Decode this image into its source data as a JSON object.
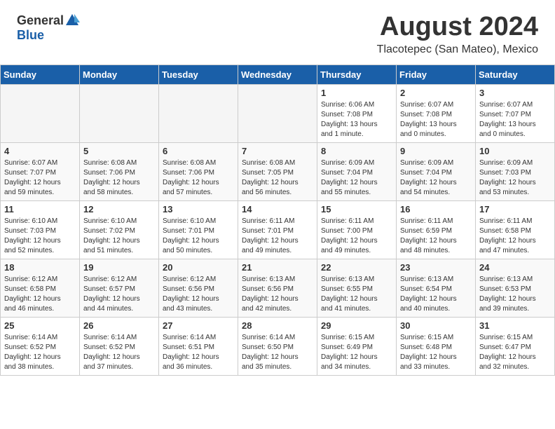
{
  "header": {
    "logo_general": "General",
    "logo_blue": "Blue",
    "month_year": "August 2024",
    "location": "Tlacotepec (San Mateo), Mexico"
  },
  "weekdays": [
    "Sunday",
    "Monday",
    "Tuesday",
    "Wednesday",
    "Thursday",
    "Friday",
    "Saturday"
  ],
  "weeks": [
    [
      {
        "day": "",
        "info": ""
      },
      {
        "day": "",
        "info": ""
      },
      {
        "day": "",
        "info": ""
      },
      {
        "day": "",
        "info": ""
      },
      {
        "day": "1",
        "info": "Sunrise: 6:06 AM\nSunset: 7:08 PM\nDaylight: 13 hours\nand 1 minute."
      },
      {
        "day": "2",
        "info": "Sunrise: 6:07 AM\nSunset: 7:08 PM\nDaylight: 13 hours\nand 0 minutes."
      },
      {
        "day": "3",
        "info": "Sunrise: 6:07 AM\nSunset: 7:07 PM\nDaylight: 13 hours\nand 0 minutes."
      }
    ],
    [
      {
        "day": "4",
        "info": "Sunrise: 6:07 AM\nSunset: 7:07 PM\nDaylight: 12 hours\nand 59 minutes."
      },
      {
        "day": "5",
        "info": "Sunrise: 6:08 AM\nSunset: 7:06 PM\nDaylight: 12 hours\nand 58 minutes."
      },
      {
        "day": "6",
        "info": "Sunrise: 6:08 AM\nSunset: 7:06 PM\nDaylight: 12 hours\nand 57 minutes."
      },
      {
        "day": "7",
        "info": "Sunrise: 6:08 AM\nSunset: 7:05 PM\nDaylight: 12 hours\nand 56 minutes."
      },
      {
        "day": "8",
        "info": "Sunrise: 6:09 AM\nSunset: 7:04 PM\nDaylight: 12 hours\nand 55 minutes."
      },
      {
        "day": "9",
        "info": "Sunrise: 6:09 AM\nSunset: 7:04 PM\nDaylight: 12 hours\nand 54 minutes."
      },
      {
        "day": "10",
        "info": "Sunrise: 6:09 AM\nSunset: 7:03 PM\nDaylight: 12 hours\nand 53 minutes."
      }
    ],
    [
      {
        "day": "11",
        "info": "Sunrise: 6:10 AM\nSunset: 7:03 PM\nDaylight: 12 hours\nand 52 minutes."
      },
      {
        "day": "12",
        "info": "Sunrise: 6:10 AM\nSunset: 7:02 PM\nDaylight: 12 hours\nand 51 minutes."
      },
      {
        "day": "13",
        "info": "Sunrise: 6:10 AM\nSunset: 7:01 PM\nDaylight: 12 hours\nand 50 minutes."
      },
      {
        "day": "14",
        "info": "Sunrise: 6:11 AM\nSunset: 7:01 PM\nDaylight: 12 hours\nand 49 minutes."
      },
      {
        "day": "15",
        "info": "Sunrise: 6:11 AM\nSunset: 7:00 PM\nDaylight: 12 hours\nand 49 minutes."
      },
      {
        "day": "16",
        "info": "Sunrise: 6:11 AM\nSunset: 6:59 PM\nDaylight: 12 hours\nand 48 minutes."
      },
      {
        "day": "17",
        "info": "Sunrise: 6:11 AM\nSunset: 6:58 PM\nDaylight: 12 hours\nand 47 minutes."
      }
    ],
    [
      {
        "day": "18",
        "info": "Sunrise: 6:12 AM\nSunset: 6:58 PM\nDaylight: 12 hours\nand 46 minutes."
      },
      {
        "day": "19",
        "info": "Sunrise: 6:12 AM\nSunset: 6:57 PM\nDaylight: 12 hours\nand 44 minutes."
      },
      {
        "day": "20",
        "info": "Sunrise: 6:12 AM\nSunset: 6:56 PM\nDaylight: 12 hours\nand 43 minutes."
      },
      {
        "day": "21",
        "info": "Sunrise: 6:13 AM\nSunset: 6:56 PM\nDaylight: 12 hours\nand 42 minutes."
      },
      {
        "day": "22",
        "info": "Sunrise: 6:13 AM\nSunset: 6:55 PM\nDaylight: 12 hours\nand 41 minutes."
      },
      {
        "day": "23",
        "info": "Sunrise: 6:13 AM\nSunset: 6:54 PM\nDaylight: 12 hours\nand 40 minutes."
      },
      {
        "day": "24",
        "info": "Sunrise: 6:13 AM\nSunset: 6:53 PM\nDaylight: 12 hours\nand 39 minutes."
      }
    ],
    [
      {
        "day": "25",
        "info": "Sunrise: 6:14 AM\nSunset: 6:52 PM\nDaylight: 12 hours\nand 38 minutes."
      },
      {
        "day": "26",
        "info": "Sunrise: 6:14 AM\nSunset: 6:52 PM\nDaylight: 12 hours\nand 37 minutes."
      },
      {
        "day": "27",
        "info": "Sunrise: 6:14 AM\nSunset: 6:51 PM\nDaylight: 12 hours\nand 36 minutes."
      },
      {
        "day": "28",
        "info": "Sunrise: 6:14 AM\nSunset: 6:50 PM\nDaylight: 12 hours\nand 35 minutes."
      },
      {
        "day": "29",
        "info": "Sunrise: 6:15 AM\nSunset: 6:49 PM\nDaylight: 12 hours\nand 34 minutes."
      },
      {
        "day": "30",
        "info": "Sunrise: 6:15 AM\nSunset: 6:48 PM\nDaylight: 12 hours\nand 33 minutes."
      },
      {
        "day": "31",
        "info": "Sunrise: 6:15 AM\nSunset: 6:47 PM\nDaylight: 12 hours\nand 32 minutes."
      }
    ]
  ]
}
